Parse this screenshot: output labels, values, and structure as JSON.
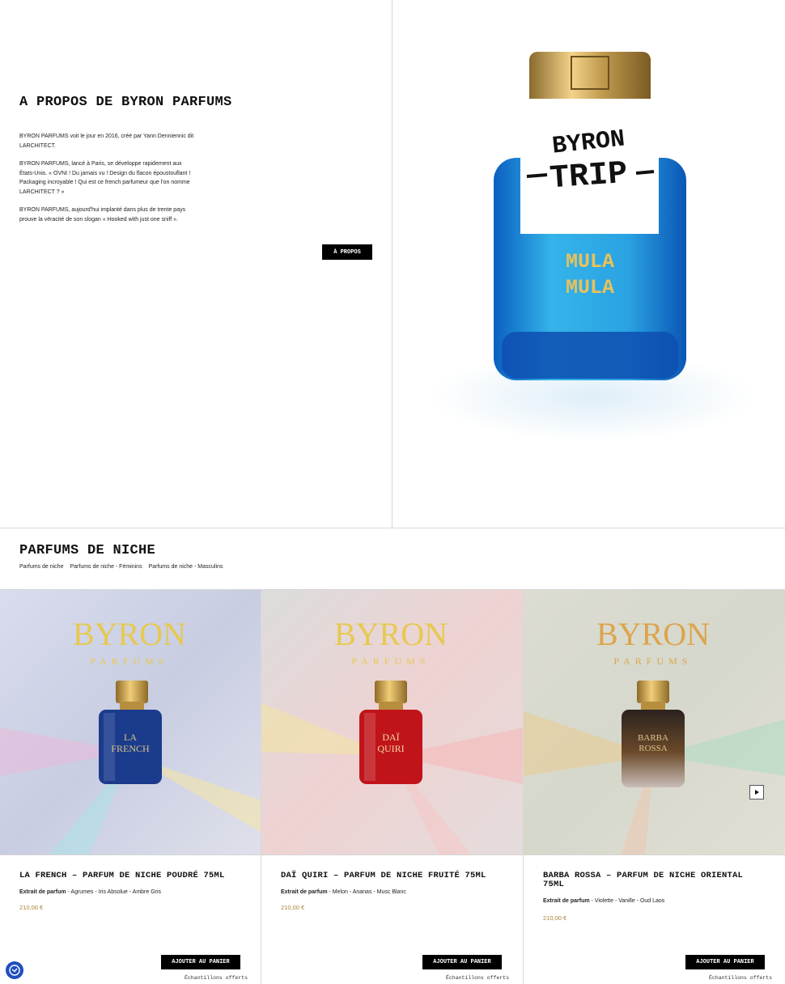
{
  "about": {
    "title": "A PROPOS DE BYRON PARFUMS",
    "paragraphs": [
      "BYRON PARFUMS voit le jour en 2016, créé par Yann Denniennic dit LARCHITECT.",
      "BYRON PARFUMS, lancé à Paris, se développe rapidement aux États-Unis. « OVNI ! Du jamais vu ! Design du flacon époustouflant ! Packaging incroyable ! Qui est ce french parfumeur que l'on nomme LARCHITECT ? »",
      "BYRON PARFUMS, aujourd'hui implanté dans plus de trente pays prouve la véracité de son slogan « Hooked with just one sniff »."
    ],
    "button_label": "À PROPOS",
    "hero": {
      "brand_line1": "BYRON",
      "brand_line2": "TRIP",
      "bottle_label_1": "MULA",
      "bottle_label_2": "MULA"
    }
  },
  "niche": {
    "title": "PARFUMS DE NICHE",
    "links": [
      "Parfums de niche",
      "Parfums de niche - Féminins",
      "Parfums de niche - Masculins"
    ]
  },
  "image_text": {
    "brand": "BYRON",
    "sub": "PARFUMS"
  },
  "products": [
    {
      "title": "LA FRENCH – PARFUM DE NICHE POUDRÉ 75ML",
      "notes_label": "Extrait de parfum",
      "notes": " - Agrumes - Iris Absolue - Ambre Gris",
      "price": "210,00 €",
      "bottle_label_1": "LA",
      "bottle_label_2": "FRENCH",
      "bottle_color": "#1b3b8c",
      "bg_tint": "#cdd3e6",
      "add_label": "AJOUTER AU PANIER",
      "sample_label": "Échantillons offerts"
    },
    {
      "title": "DAÏ QUIRI – PARFUM DE NICHE FRUITÉ 75ML",
      "notes_label": "Extrait de parfum",
      "notes": " - Melon - Ananas - Musc Blanc",
      "price": "210,00 €",
      "bottle_label_1": "DAÏ",
      "bottle_label_2": "QUIRI",
      "bottle_color": "#c0141a",
      "bg_tint": "#ecd6d6",
      "add_label": "AJOUTER AU PANIER",
      "sample_label": "Échantillons offerts"
    },
    {
      "title": "BARBA ROSSA – PARFUM DE NICHE ORIENTAL 75ML",
      "notes_label": "Extrait de parfum",
      "notes": " - Violette - Vanille - Oud Laos",
      "price": "210,00 €",
      "bottle_label_1": "BARBA",
      "bottle_label_2": "ROSSA",
      "bottle_color": "#3a2c24",
      "bg_tint": "#dcd9cf",
      "add_label": "AJOUTER AU PANIER",
      "sample_label": "Échantillons offerts"
    }
  ]
}
